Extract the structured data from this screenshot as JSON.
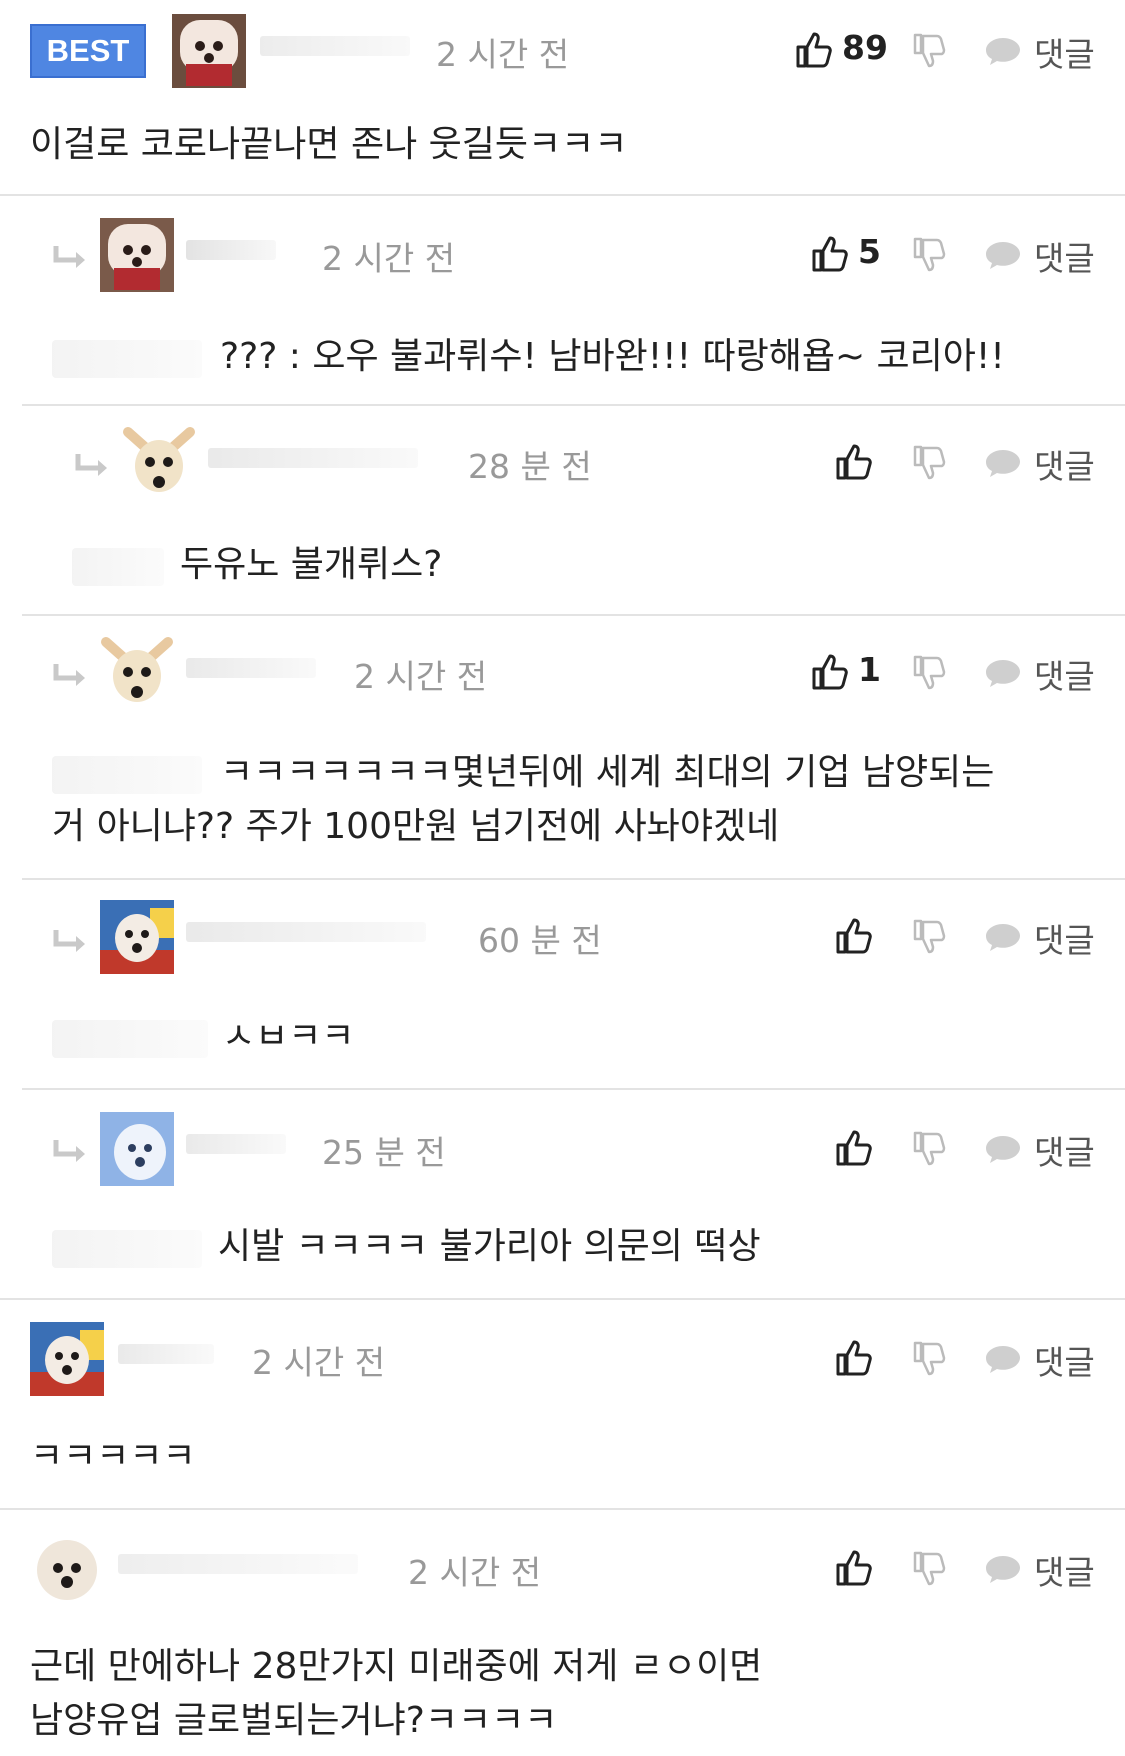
{
  "colors": {
    "best_badge": "#4f86e2",
    "time_text": "#999999",
    "divider": "#e3e3e3"
  },
  "best_label": "BEST",
  "reply_label": "댓글",
  "comments": [
    {
      "id": "c0",
      "time": "2 시간 전",
      "likes": "89",
      "text": "이걸로 코로나끝나면 존나 웃길듯ㅋㅋㅋ",
      "avatar": "white-dog-red-scarf"
    },
    {
      "id": "c1",
      "time": "2 시간 전",
      "likes": "5",
      "text": "??? : 오우 불과뤼수! 남바완!!! 따랑해욥~ 코리아!!",
      "avatar": "white-dog-red-scarf"
    },
    {
      "id": "c2",
      "time": "28 분 전",
      "likes": "",
      "text": "두유노 불개뤼스?",
      "avatar": "chihuahua"
    },
    {
      "id": "c3",
      "time": "2 시간 전",
      "likes": "1",
      "text": "ㅋㅋㅋㅋㅋㅋㅋ몇년뒤에 세계 최대의 기업 남양되는\n거 아니냐?? 주가 100만원 넘기전에 사놔야겠네",
      "avatar": "chihuahua"
    },
    {
      "id": "c4",
      "time": "60 분 전",
      "likes": "",
      "text": "ㅅㅂㅋㅋ",
      "avatar": "dog-colorful"
    },
    {
      "id": "c5",
      "time": "25 분 전",
      "likes": "",
      "text": "시발 ㅋㅋㅋㅋ 불가리아 의문의 떡상",
      "avatar": "white-dog-blue"
    },
    {
      "id": "c6",
      "time": "2 시간 전",
      "likes": "",
      "text": "ㅋㅋㅋㅋㅋ",
      "avatar": "dog-colorful"
    },
    {
      "id": "c7",
      "time": "2 시간 전",
      "likes": "",
      "text": "근데 만에하나 28만가지 미래중에 저게 ㄹㅇ이면\n남양유업 글로벌되는거냐?ㅋㅋㅋㅋ",
      "avatar": "bichon"
    }
  ]
}
